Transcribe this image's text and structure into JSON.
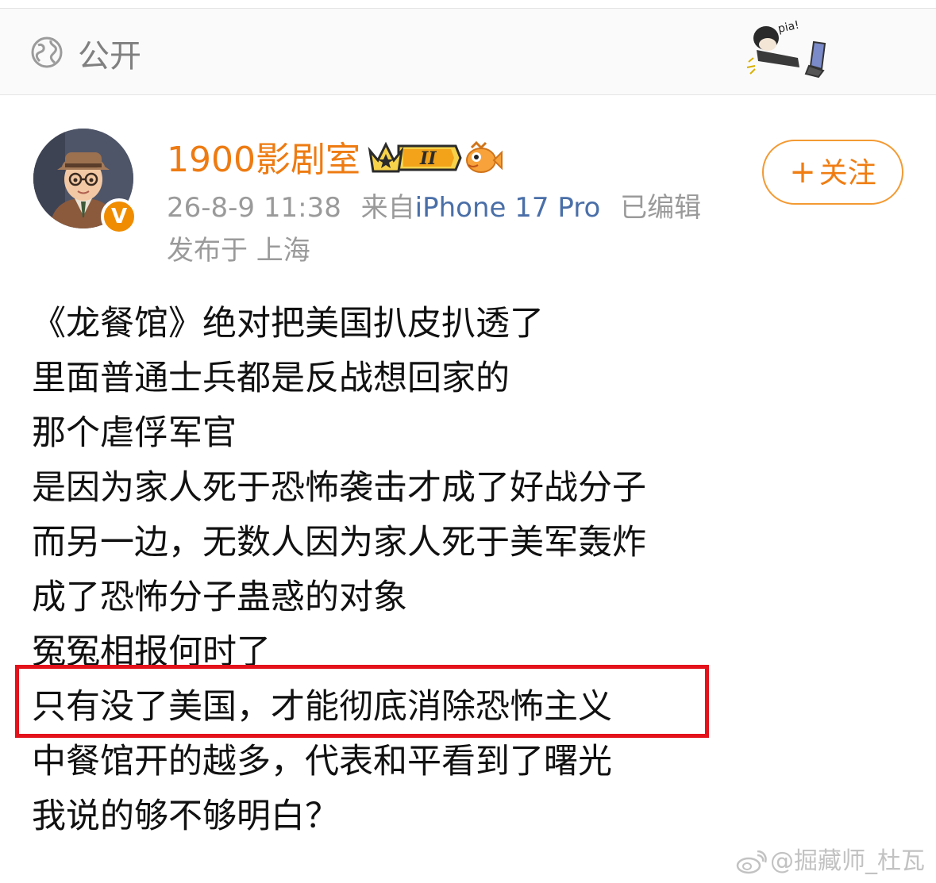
{
  "header": {
    "visibility_label": "公开"
  },
  "profile": {
    "username": "1900影剧室",
    "vip_level": "II",
    "verified_mark": "V",
    "follow_label": "关注",
    "timestamp": "26-8-9 11:38",
    "source_prefix": "来自",
    "device": "iPhone 17 Pro",
    "edited": "已编辑",
    "location": "发布于 上海"
  },
  "post": {
    "lines": [
      "《龙餐馆》绝对把美国扒皮扒透了",
      "里面普通士兵都是反战想回家的",
      "那个虐俘军官",
      "是因为家人死于恐怖袭击才成了好战分子",
      "而另一边，无数人因为家人死于美军轰炸",
      "成了恐怖分子蛊惑的对象",
      "冤冤相报何时了",
      "只有没了美国，才能彻底消除恐怖主义",
      "中餐馆开的越多，代表和平看到了曙光",
      "我说的够不够明白？"
    ],
    "highlighted_line_index": 7
  },
  "sticker": {
    "text": "pia!"
  },
  "watermark": "@掘藏师_杜瓦",
  "colors": {
    "username": "#ee7b12",
    "follow_border": "#f39a33",
    "device_link": "#4a6fa8",
    "highlight_box": "#e3121b",
    "muted_text": "#9a9a9a"
  },
  "icons": [
    "globe-icon",
    "vip-crown-icon",
    "fish-emoji-icon",
    "verified-v-icon",
    "plus-icon",
    "weibo-logo-icon"
  ]
}
